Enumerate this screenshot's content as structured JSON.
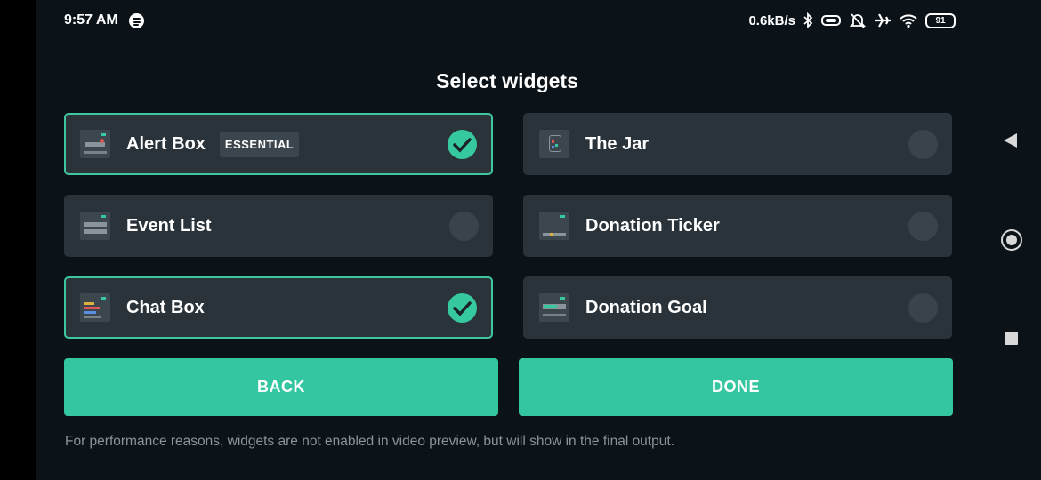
{
  "status_bar": {
    "time": "9:57 AM",
    "speed": "0.6kB/s",
    "battery": "91",
    "icons": [
      "spotify-icon",
      "bluetooth-icon",
      "vibrate-icon",
      "alarm-off-icon",
      "airplane-icon",
      "wifi-icon",
      "battery-icon"
    ]
  },
  "title": "Select widgets",
  "widgets": [
    {
      "label": "Alert Box",
      "badge": "ESSENTIAL",
      "selected": true,
      "icon": "alert-box-thumbnail-icon"
    },
    {
      "label": "The Jar",
      "selected": false,
      "icon": "jar-thumbnail-icon"
    },
    {
      "label": "Event List",
      "selected": false,
      "icon": "event-list-thumbnail-icon"
    },
    {
      "label": "Donation Ticker",
      "selected": false,
      "icon": "donation-ticker-thumbnail-icon"
    },
    {
      "label": "Chat Box",
      "selected": true,
      "icon": "chat-box-thumbnail-icon"
    },
    {
      "label": "Donation Goal",
      "selected": false,
      "icon": "donation-goal-thumbnail-icon"
    }
  ],
  "buttons": {
    "back": "BACK",
    "done": "DONE"
  },
  "footer_note": "For performance reasons, widgets are not enabled in video preview, but will show in the final output.",
  "colors": {
    "accent": "#33c6a0",
    "card": "#2a333a",
    "background": "#0b1319"
  },
  "nav": {
    "icons": [
      "back-icon",
      "home-icon",
      "recents-icon"
    ]
  }
}
